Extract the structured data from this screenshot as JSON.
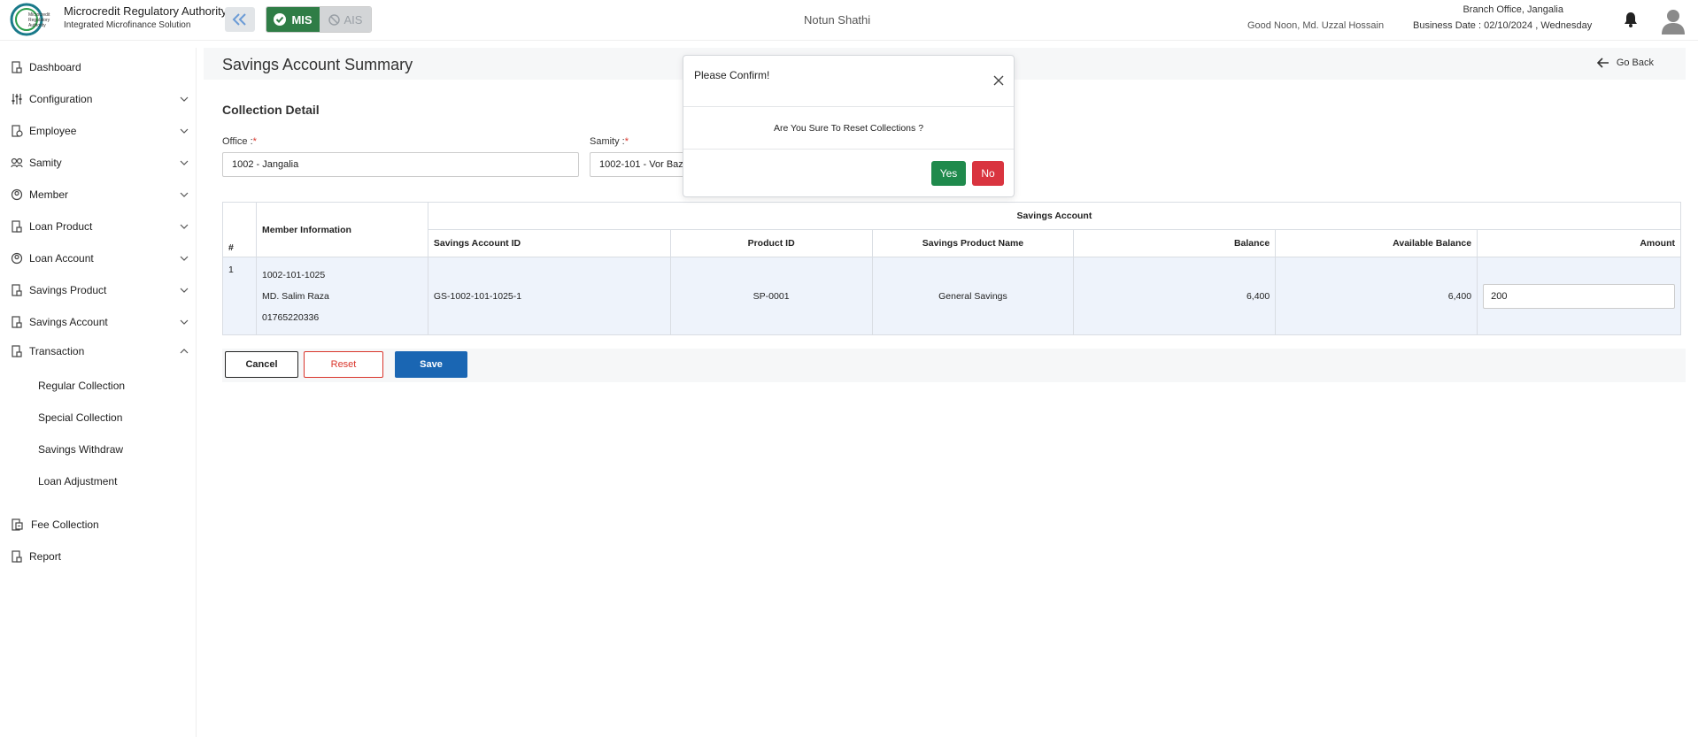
{
  "header": {
    "org_title": "Microcredit Regulatory Authority",
    "org_subtitle": "Integrated Microfinance Solution",
    "logo_text": [
      "Microcredit",
      "Regulatory",
      "Authority"
    ],
    "mode_mis": "MIS",
    "mode_ais": "AIS",
    "app_name": "Notun Shathi",
    "greeting": "Good Noon, Md. Uzzal Hossain",
    "branch": "Branch Office, Jangalia",
    "business_date": "Business Date : 02/10/2024 , Wednesday"
  },
  "sidebar": {
    "items": [
      {
        "label": "Dashboard",
        "icon": "document-icon"
      },
      {
        "label": "Configuration",
        "icon": "sliders-icon"
      },
      {
        "label": "Employee",
        "icon": "employee-icon"
      },
      {
        "label": "Samity",
        "icon": "group-icon"
      },
      {
        "label": "Member",
        "icon": "member-icon"
      },
      {
        "label": "Loan Product",
        "icon": "document-icon"
      },
      {
        "label": "Loan Account",
        "icon": "member-icon"
      },
      {
        "label": "Savings Product",
        "icon": "document-icon"
      },
      {
        "label": "Savings Account",
        "icon": "document-icon"
      },
      {
        "label": "Transaction",
        "icon": "document-icon"
      }
    ],
    "transaction_sub": [
      "Regular Collection",
      "Special Collection",
      "Savings Withdraw",
      "Loan Adjustment"
    ],
    "fee_collection": "Fee Collection",
    "report": "Report"
  },
  "page": {
    "title": "Savings Account Summary",
    "go_back": "Go Back",
    "section_title": "Collection Detail",
    "office_label": "Office :",
    "office_value": "1002 - Jangalia",
    "samity_label": "Samity :",
    "samity_value": "1002-101 - Vor Bazar"
  },
  "table": {
    "hash": "#",
    "member_info": "Member Information",
    "savings_account": "Savings Account",
    "columns": [
      "Savings Account ID",
      "Product ID",
      "Savings Product Name",
      "Balance",
      "Available Balance",
      "Amount"
    ],
    "rows": [
      {
        "index": "1",
        "member_id": "1002-101-1025",
        "member_name": "MD. Salim Raza",
        "member_phone": "01765220336",
        "account_id": "GS-1002-101-1025-1",
        "product_id": "SP-0001",
        "product_name": "General Savings",
        "balance": "6,400",
        "available_balance": "6,400",
        "amount": "200"
      }
    ]
  },
  "buttons": {
    "cancel": "Cancel",
    "reset": "Reset",
    "save": "Save"
  },
  "modal": {
    "title": "Please Confirm!",
    "message": "Are You Sure To Reset Collections ?",
    "yes": "Yes",
    "no": "No"
  },
  "colors": {
    "mis_green": "#2f7d46",
    "save_blue": "#1a66b3",
    "reset_red": "#d9352b",
    "yes_green": "#1f8a4c",
    "no_red": "#d9343f"
  }
}
